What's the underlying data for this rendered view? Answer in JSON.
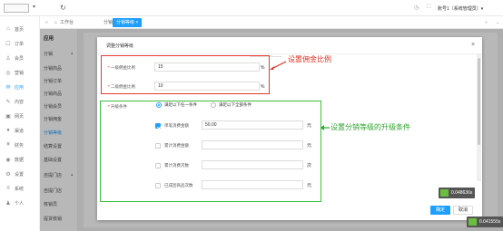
{
  "topbar": {
    "account": "账号1（系统管理员）",
    "account_caret": "▾"
  },
  "icon_column": [
    {
      "glyph": "⌂",
      "label": "首页",
      "icon": "home-icon"
    },
    {
      "glyph": "☐",
      "label": "订单",
      "icon": "order-icon"
    },
    {
      "glyph": "♙",
      "label": "会员",
      "icon": "member-icon"
    },
    {
      "glyph": "◎",
      "label": "营销",
      "icon": "marketing-icon"
    },
    {
      "glyph": "✉",
      "label": "应用",
      "icon": "app-icon"
    },
    {
      "glyph": "✎",
      "label": "内容",
      "icon": "content-icon"
    },
    {
      "glyph": "▣",
      "label": "网页",
      "icon": "web-icon"
    },
    {
      "glyph": "●",
      "label": "渠道",
      "icon": "channel-icon"
    },
    {
      "glyph": "¥",
      "label": "财务",
      "icon": "finance-icon"
    },
    {
      "glyph": "◉",
      "label": "数据",
      "icon": "data-icon"
    },
    {
      "glyph": "⚙",
      "label": "设置",
      "icon": "settings-icon"
    },
    {
      "glyph": "≡",
      "label": "系统",
      "icon": "system-icon"
    },
    {
      "glyph": "♟",
      "label": "个人",
      "icon": "personal-icon"
    }
  ],
  "second_column": {
    "heading": "应用",
    "items": [
      "分销",
      "分销商品",
      "分销订单",
      "分销商品",
      "分销会员",
      "分销佣金",
      "分销等级",
      "结算设置",
      "基础设置",
      "自提门店",
      "自提门店",
      "核销员",
      "提货核销"
    ]
  },
  "tabs": {
    "workbench": "工作台",
    "distribution_goods": "分销商品",
    "distribution_level": "分销等级"
  },
  "modal": {
    "title": "调整分销等级",
    "ruler": "──────────",
    "first_rate_label": "一级佣金比例",
    "first_rate_value": "15",
    "second_rate_label": "二级佣金比例",
    "second_rate_value": "10",
    "percent_unit": "%",
    "upgrade_label": "升级条件",
    "radio_any": "满足以下任一条件",
    "radio_all": "满足以下全部条件",
    "conditions": [
      {
        "label": "单笔消费金额",
        "value": "50.00",
        "unit": "元",
        "checked": true
      },
      {
        "label": "累计消费金额",
        "value": "",
        "unit": "元",
        "checked": false
      },
      {
        "label": "累计消费次数",
        "value": "",
        "unit": "次",
        "checked": false
      },
      {
        "label": "已成团商品次数",
        "value": "",
        "unit": "元",
        "checked": false
      }
    ],
    "ok": "确定",
    "cancel": "取消"
  },
  "annotations": {
    "red": "设置佣金比例",
    "green": "设置分销等级的升级条件"
  },
  "badges": {
    "timer_1": "0.048636s",
    "timer_2": "0.041555s"
  },
  "colors": {
    "accent": "#1e9fff",
    "red_annotation": "#e03020",
    "green_annotation": "#2fa52f"
  }
}
